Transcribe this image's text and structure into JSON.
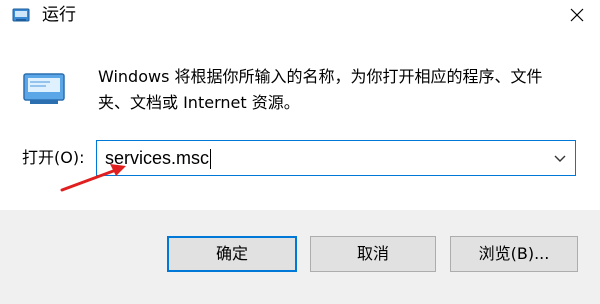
{
  "window": {
    "title": "运行",
    "close_icon": "close-icon"
  },
  "dialog": {
    "description_line1": "Windows 将根据你所输入的名称，为你打开相应的程序、文件",
    "description_line2": "夹、文档或 Internet 资源。",
    "open_label": "打开(O):",
    "input_value": "services.msc",
    "dropdown_icon": "chevron-down-icon"
  },
  "buttons": {
    "ok": "确定",
    "cancel": "取消",
    "browse": "浏览(B)..."
  },
  "colors": {
    "accent": "#0078d7",
    "annotation_arrow": "#e02020",
    "footer_bg": "#f0f0f0"
  }
}
